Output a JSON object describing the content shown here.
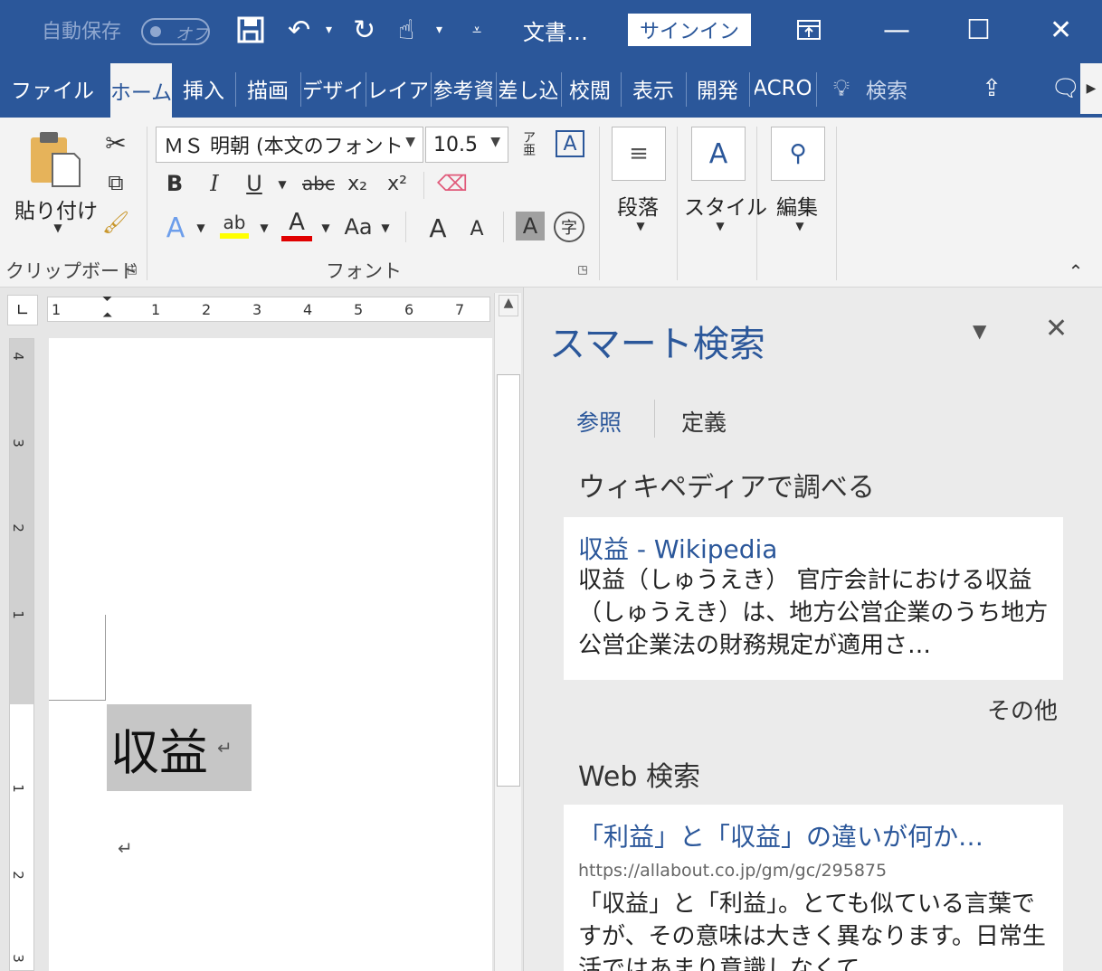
{
  "titlebar": {
    "autosave_label": "自動保存",
    "autosave_toggle": "オフ",
    "doc_title": "文書…",
    "signin_label": "サインイン"
  },
  "tabs": [
    "ファイル",
    "ホーム",
    "挿入",
    "描画",
    "デザイ",
    "レイア",
    "参考資",
    "差し込",
    "校閲",
    "表示",
    "開発",
    "ACRO",
    "検索"
  ],
  "ribbon": {
    "clipboard": {
      "paste_label": "貼り付け",
      "group_label": "クリップボード"
    },
    "font": {
      "font_name": "ＭＳ 明朝 (本文のフォント",
      "font_size": "10.5",
      "group_label": "フォント",
      "bold": "B",
      "italic": "I",
      "underline": "U",
      "strike": "abc",
      "sub": "x₂",
      "sup": "x²",
      "case": "Aa",
      "grow": "A",
      "shrink": "A",
      "char_shading": "A",
      "enclose": "字"
    },
    "paragraph_label": "段落",
    "styles_label": "スタイル",
    "editing_label": "編集"
  },
  "ruler": {
    "h_ticks": [
      "1",
      "1",
      "1",
      "2",
      "3",
      "4",
      "5",
      "6",
      "7"
    ],
    "v_ticks": [
      "4",
      "3",
      "2",
      "1",
      "1",
      "2",
      "3"
    ]
  },
  "document": {
    "selected_word": "収益",
    "para_mark": "↵"
  },
  "pane": {
    "title": "スマート検索",
    "tab_explore": "参照",
    "tab_define": "定義",
    "wiki_heading": "ウィキペディアで調べる",
    "wiki_card": {
      "title": "収益 - Wikipedia",
      "body": "収益（しゅうえき） 官庁会計における収益（しゅうえき）は、地方公営企業のうち地方公営企業法の財務規定が適用さ…"
    },
    "more_label": "その他",
    "web_heading": "Web 検索",
    "web_card": {
      "title": "「利益」と「収益」の違いが何か…",
      "url": "https://allabout.co.jp/gm/gc/295875",
      "body": "「収益」と「利益」。とても似ている言葉ですが、その意味は大きく異なります。日常生活ではあまり意識しなくて"
    }
  },
  "colors": {
    "brand": "#2b579a",
    "highlight": "#ffff00",
    "font_color": "#e00000"
  }
}
